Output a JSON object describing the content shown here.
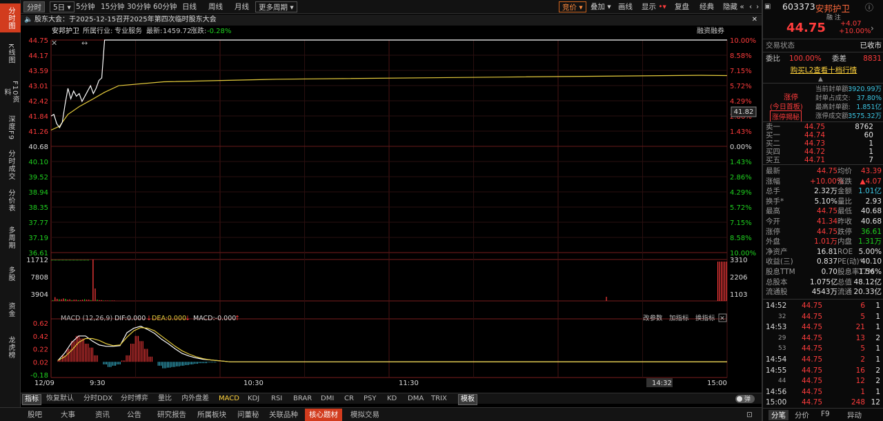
{
  "leftnav": [
    "分时图",
    "K线图",
    "F10资料",
    "深度F9",
    "分时成交",
    "分价表",
    "多周期",
    "多股",
    "资金",
    "龙虎榜"
  ],
  "topbar": {
    "periods": [
      "分时",
      "5日",
      "5分钟",
      "15分钟",
      "30分钟",
      "60分钟",
      "日线",
      "周线",
      "月线",
      "更多周期"
    ],
    "right": [
      "竞价",
      "叠加",
      "画线",
      "显示",
      "复盘",
      "经典",
      "隐藏"
    ]
  },
  "notice": "股东大会：于2025-12-15召开2025年第四次临时股东大会",
  "info": {
    "name": "安邦护卫",
    "industry_label": "所属行业:",
    "industry": "专业服务",
    "latest_label": "最新:",
    "latest": "1459.72",
    "change_label": "涨跌:",
    "change": "-0.28%",
    "margin_btn": "融资融券"
  },
  "price_axis": {
    "left": [
      "44.75",
      "44.17",
      "43.59",
      "43.01",
      "42.42",
      "41.84",
      "41.26",
      "40.68",
      "40.10",
      "39.52",
      "38.94",
      "38.35",
      "37.77",
      "37.19",
      "36.61"
    ],
    "right": [
      "10.00%",
      "8.58%",
      "7.15%",
      "5.72%",
      "4.29%",
      "2.86%",
      "1.43%",
      "0.00%",
      "1.43%",
      "2.86%",
      "4.29%",
      "5.72%",
      "7.15%",
      "8.58%",
      "10.00%"
    ],
    "cursor_value": "41.82"
  },
  "volume_axis": {
    "left": [
      "11712",
      "7808",
      "3904"
    ],
    "right": [
      "3310",
      "2206",
      "1103"
    ]
  },
  "macd": {
    "title": "MACD (12,26,9)",
    "dif": "DIF:0.000",
    "dea": "DEA:0.000",
    "macd": "MACD:-0.000",
    "axis": [
      "0.62",
      "0.42",
      "0.22",
      "0.02",
      "-0.18"
    ],
    "tools": [
      "改参数",
      "加指标",
      "换指标"
    ]
  },
  "time_axis": {
    "labels": [
      "12/09",
      "9:30",
      "10:30",
      "11:30",
      "14:32",
      "15:00"
    ]
  },
  "indicator_bar": [
    "指标",
    "恢复默认",
    "分时DDX",
    "分时博弈",
    "量比",
    "内外盘差",
    "MACD",
    "KDJ",
    "RSI",
    "BRAR",
    "DMI",
    "CR",
    "PSY",
    "KD",
    "DMA",
    "TRIX",
    "模板"
  ],
  "footer": [
    "股吧",
    "大事",
    "资讯",
    "公告",
    "研究报告",
    "所属板块",
    "问董秘",
    "关联品种",
    "核心题材",
    "模拟交易"
  ],
  "quote": {
    "code": "603373",
    "name": "安邦护卫",
    "tags": "融 注",
    "price": "44.75",
    "chg": "+4.07",
    "pct": "+10.00%",
    "status_label": "交易状态",
    "status": "已收市",
    "weibi_label": "委比",
    "weibi": "100.00%",
    "weicha_label": "委差",
    "weicha": "8831",
    "l2": "购买L2查看十档行情",
    "limit_label": "涨停",
    "limit_today": "(今日首板)",
    "limit_btn": "涨停揭秘",
    "limit_rows": [
      [
        "当前封单额:",
        "3920.99万"
      ],
      [
        "封单占成交:",
        "37.80%"
      ],
      [
        "最高封单额:",
        "1.851亿"
      ],
      [
        "涨停成交额:",
        "3575.32万"
      ]
    ],
    "book": [
      [
        "卖一",
        "44.75",
        "8762"
      ],
      [
        "买一",
        "44.74",
        "60"
      ],
      [
        "买二",
        "44.73",
        "1"
      ],
      [
        "买四",
        "44.72",
        "1"
      ],
      [
        "买五",
        "44.71",
        "7"
      ]
    ],
    "stats": [
      [
        "最新",
        "44.75",
        "均价",
        "43.39"
      ],
      [
        "涨幅",
        "+10.00%",
        "涨跌",
        "▲4.07"
      ],
      [
        "总手",
        "2.32万",
        "金额",
        "1.01亿"
      ],
      [
        "换手*",
        "5.10%",
        "量比",
        "2.93"
      ],
      [
        "最高",
        "44.75",
        "最低",
        "40.68"
      ],
      [
        "今开",
        "41.34",
        "昨收",
        "40.68"
      ],
      [
        "涨停",
        "44.75",
        "跌停",
        "36.61"
      ],
      [
        "外盘",
        "1.01万",
        "内盘",
        "1.31万"
      ],
      [
        "净资产",
        "16.81",
        "ROE",
        "5.00%"
      ],
      [
        "收益(三)",
        "0.837",
        "PE(动)*",
        "40.10"
      ],
      [
        "股息TTM",
        "0.70",
        "股息率TTM",
        "1.56%"
      ],
      [
        "总股本",
        "1.075亿",
        "总值",
        "48.12亿"
      ],
      [
        "流通股",
        "4543万",
        "流通",
        "20.33亿"
      ]
    ]
  },
  "ticks": [
    [
      "14:52",
      "44.75",
      "6",
      "1"
    ],
    [
      "32",
      "44.75",
      "5",
      "1"
    ],
    [
      "14:53",
      "44.75",
      "21",
      "1"
    ],
    [
      "29",
      "44.75",
      "13",
      "2"
    ],
    [
      "53",
      "44.75",
      "5",
      "1"
    ],
    [
      "14:54",
      "44.75",
      "2",
      "1"
    ],
    [
      "14:55",
      "44.75",
      "16",
      "2"
    ],
    [
      "44",
      "44.75",
      "12",
      "2"
    ],
    [
      "14:56",
      "44.75",
      "1",
      "1"
    ],
    [
      "15:00",
      "44.75",
      "248",
      "12"
    ]
  ],
  "right_tabs": [
    "分笔",
    "分价",
    "F9",
    "异动"
  ],
  "colors": {
    "up": "#ff3c3c",
    "down": "#1fd21f",
    "price_line": "#ffffff",
    "avg_line": "#e6cc3c",
    "accent": "#d23c1e"
  },
  "chart_data": {
    "type": "line",
    "price_points": [
      [
        0,
        41.84
      ],
      [
        1,
        41.9
      ],
      [
        2,
        41.55
      ],
      [
        3,
        41.4
      ],
      [
        4,
        41.6
      ],
      [
        5,
        42.3
      ],
      [
        6,
        42.9
      ],
      [
        7,
        42.5
      ],
      [
        8,
        42.8
      ],
      [
        9,
        42.6
      ],
      [
        10,
        42.7
      ],
      [
        11,
        42.4
      ],
      [
        12,
        42.6
      ],
      [
        13,
        42.8
      ],
      [
        14,
        43.0
      ],
      [
        15,
        42.7
      ],
      [
        16,
        42.9
      ],
      [
        17,
        43.2
      ],
      [
        18,
        43.3
      ],
      [
        19,
        44.75
      ],
      [
        20,
        44.75
      ],
      [
        240,
        44.75
      ]
    ],
    "avg_points": [
      [
        0,
        41.3
      ],
      [
        3,
        41.45
      ],
      [
        6,
        41.9
      ],
      [
        10,
        42.2
      ],
      [
        15,
        42.5
      ],
      [
        19,
        42.75
      ],
      [
        24,
        43.0
      ],
      [
        40,
        43.15
      ],
      [
        80,
        43.25
      ],
      [
        160,
        43.33
      ],
      [
        230,
        43.4
      ],
      [
        240,
        43.39
      ]
    ],
    "volume": [
      2,
      9,
      5,
      4,
      4,
      6,
      5,
      3,
      4,
      2,
      3,
      3,
      2,
      2,
      3,
      4,
      3,
      3,
      2,
      100,
      30,
      3,
      2,
      2,
      1,
      1,
      1,
      1,
      1,
      1
    ],
    "macd_hist": [
      0.03,
      0.1,
      0.2,
      0.32,
      0.4,
      0.36,
      0.28,
      0.22,
      0.1,
      0.0,
      -0.04,
      -0.08,
      -0.06,
      -0.04,
      0.02,
      0.1,
      0.28,
      0.4,
      0.32,
      0.2,
      0.08,
      0.0,
      -0.06,
      -0.1,
      -0.09,
      -0.08,
      -0.07,
      -0.06,
      -0.05,
      -0.04,
      -0.03,
      -0.02,
      -0.02,
      -0.01,
      -0.01,
      0,
      0,
      0,
      0,
      0
    ],
    "dif": [
      0.02,
      0.14,
      0.3,
      0.4,
      0.4,
      0.32,
      0.26,
      0.24,
      0.24,
      0.25,
      0.45,
      0.52,
      0.55,
      0.5,
      0.44,
      0.35,
      0.28,
      0.2,
      0.13,
      0.09,
      0.06,
      0.04,
      0.03,
      0.02,
      0.01,
      0.0,
      0.0,
      0.0
    ],
    "dea": [
      0.02,
      0.08,
      0.18,
      0.3,
      0.36,
      0.36,
      0.33,
      0.28,
      0.25,
      0.26,
      0.38,
      0.48,
      0.53,
      0.52,
      0.48,
      0.4,
      0.32,
      0.24,
      0.17,
      0.12,
      0.08,
      0.05,
      0.03,
      0.02,
      0.01,
      0.0,
      0.0,
      0.0
    ]
  }
}
